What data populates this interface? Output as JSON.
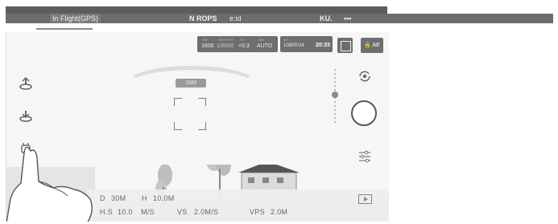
{
  "status": {
    "flight_mode": "In Flight(GPS)",
    "warning": "N ROPS",
    "signal": "e:id",
    "brand": "KU.",
    "menu": "•••"
  },
  "camera": {
    "iso_label": "ISO",
    "iso": "1600",
    "shutter_label": "SHUTTER",
    "shutter": "1/8000",
    "ev_label": "EV",
    "ev": "+0.3",
    "wb_label": "WB",
    "wb": "AUTO",
    "rec_label": "SD",
    "resolution": "1080P/24",
    "rec_time": "20:33",
    "ae_label": "AE"
  },
  "hud": {
    "altitude_badge": "16M"
  },
  "telemetry": {
    "d_label": "D",
    "d_value": "30M",
    "h_label": "H",
    "h_value": "10.0M",
    "hs_label": "H.S",
    "hs_value": "10.0",
    "hs_unit": "M/S",
    "vs_label": "VS",
    "vs_value": "2.0M/S",
    "vps_label": "VPS",
    "vps_value": "2.0M"
  },
  "icons": {
    "takeoff": "takeoff-icon",
    "return_home": "return-home-icon",
    "intelligent_flight": "intelligent-flight-icon",
    "camera_switch": "camera-switch-icon",
    "camera_settings": "camera-settings-icon",
    "shutter": "shutter-button",
    "playback": "playback-icon",
    "lock": "lock-icon"
  },
  "colors": {
    "bar_dark": "#5d5d5d",
    "panel": "#6e6e6e",
    "background": "#f6f6f6"
  }
}
